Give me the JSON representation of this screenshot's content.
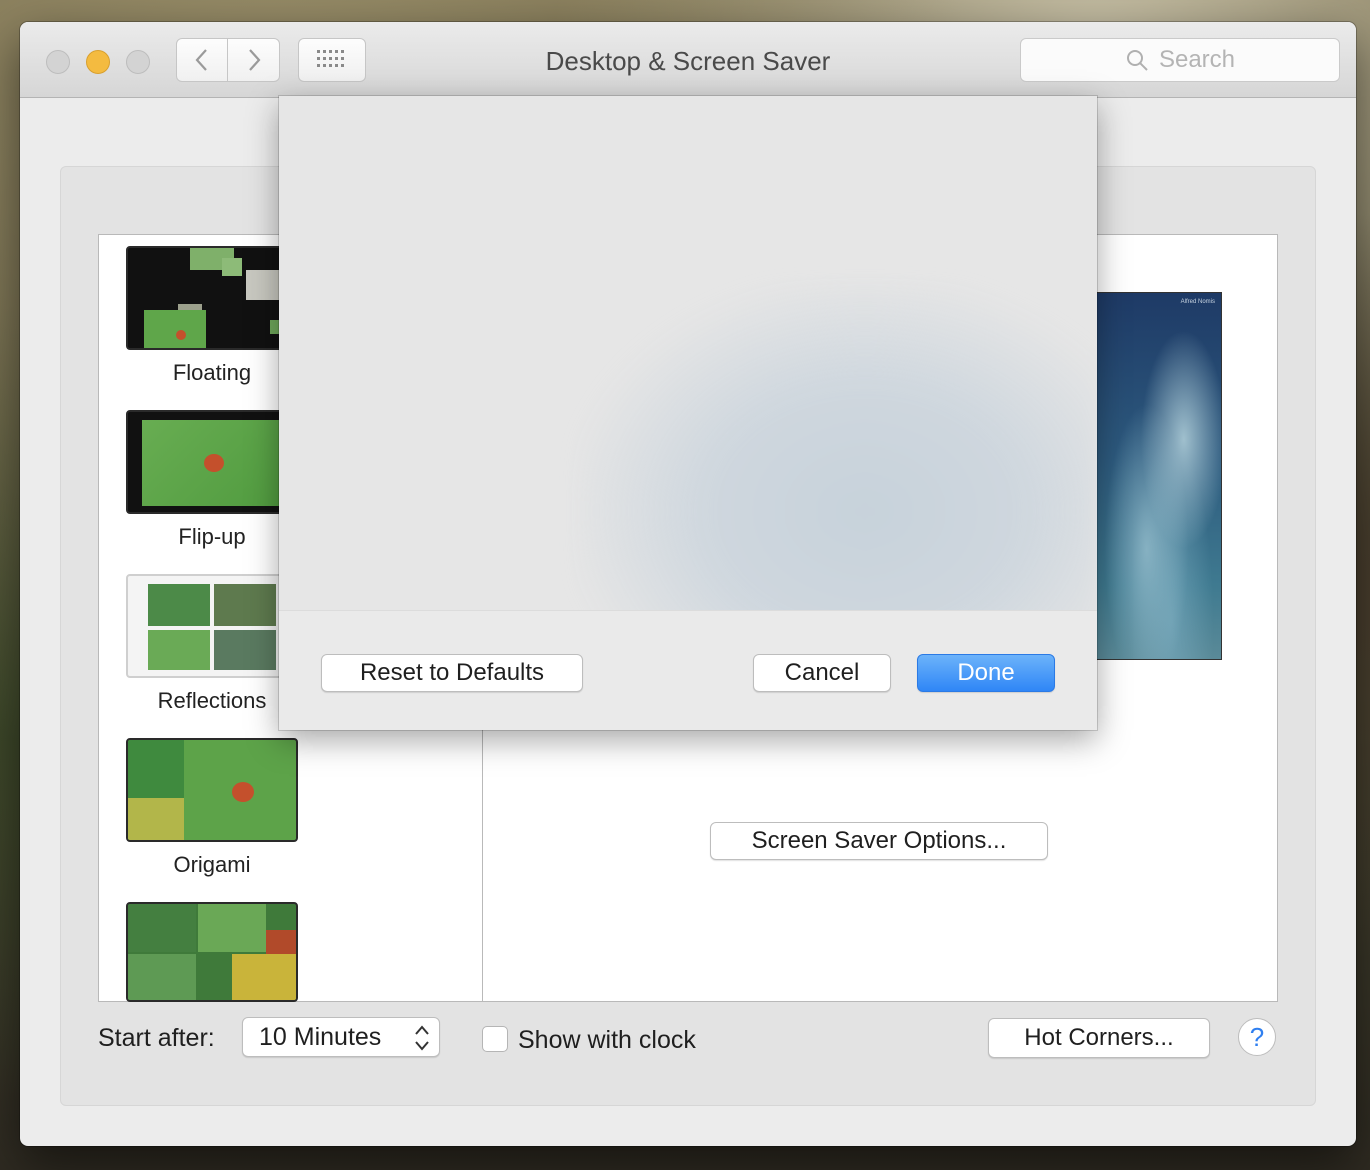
{
  "window": {
    "title": "Desktop & Screen Saver",
    "search_placeholder": "Search"
  },
  "screen_savers": [
    {
      "label": "Floating"
    },
    {
      "label": "Flip-up"
    },
    {
      "label": "Reflections"
    },
    {
      "label": "Origami"
    },
    {
      "label": ""
    }
  ],
  "preview": {
    "credit": "Alfred Nomis",
    "options_button": "Screen Saver Options..."
  },
  "sheet": {
    "reset_button": "Reset to Defaults",
    "cancel_button": "Cancel",
    "done_button": "Done"
  },
  "footer": {
    "start_after_label": "Start after:",
    "start_after_value": "10 Minutes",
    "show_clock_label": "Show with clock",
    "show_clock_checked": false,
    "hot_corners_button": "Hot Corners...",
    "help_button": "?"
  },
  "colors": {
    "accent": "#2f86f6",
    "minimize_light": "#f4bb40"
  }
}
